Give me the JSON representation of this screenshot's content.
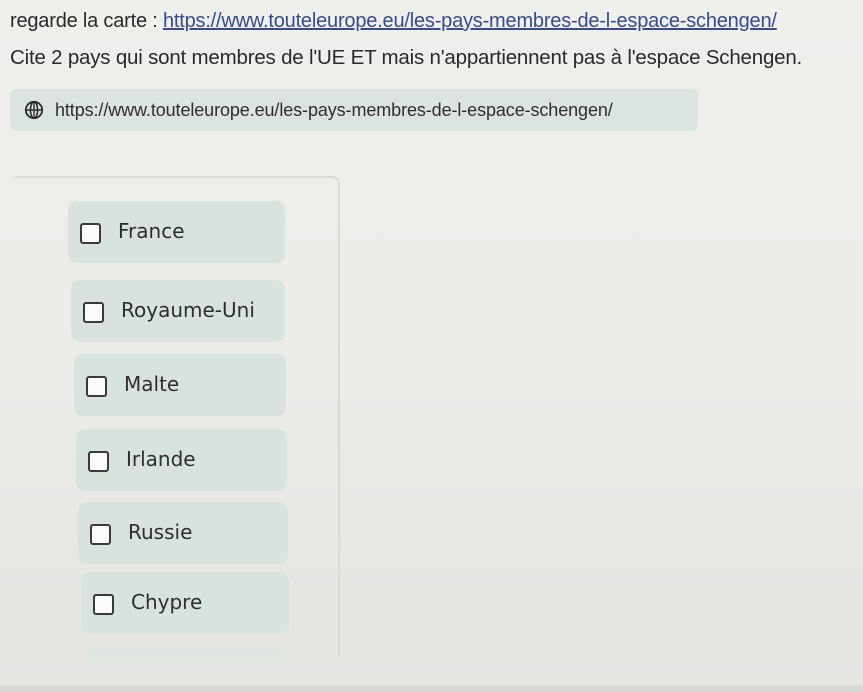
{
  "instructions": {
    "line1_prefix": "regarde la carte  : ",
    "link_text": "https://www.touteleurope.eu/les-pays-membres-de-l-espace-schengen/",
    "line2": "Cite 2 pays qui sont membres de l'UE ET mais n'appartiennent pas à l'espace Schengen."
  },
  "link_chip": {
    "icon": "globe-icon",
    "text": "https://www.touteleurope.eu/les-pays-membres-de-l-espace-schengen/"
  },
  "options": [
    {
      "label": "France",
      "checked": false
    },
    {
      "label": "Royaume-Uni",
      "checked": false
    },
    {
      "label": "Malte",
      "checked": false
    },
    {
      "label": "Irlande",
      "checked": false
    },
    {
      "label": "Russie",
      "checked": false
    },
    {
      "label": "Chypre",
      "checked": false
    }
  ],
  "colors": {
    "background": "#ecece9",
    "option_fill": "#d9e3de",
    "link_color": "#3a4a8c"
  }
}
